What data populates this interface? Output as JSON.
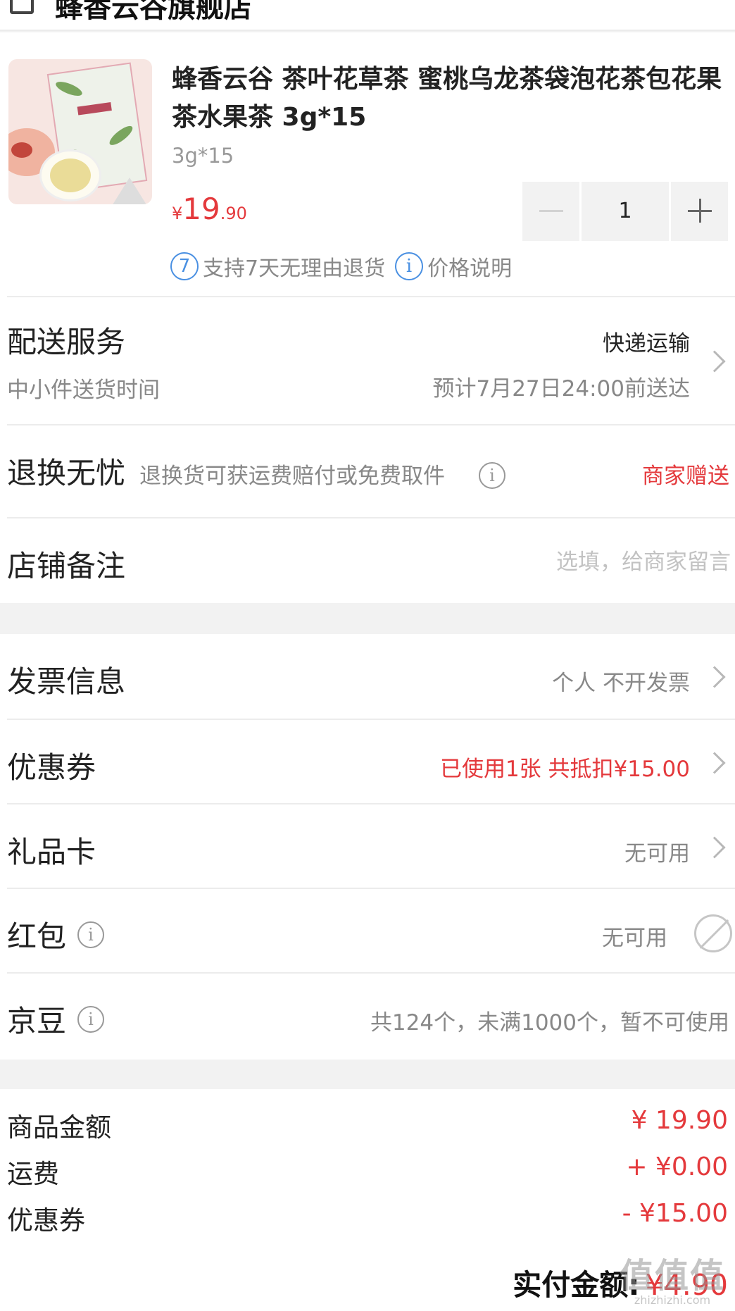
{
  "store": {
    "name": "蜂香云谷旗舰店"
  },
  "product": {
    "title": "蜂香云谷 茶叶花草茶 蜜桃乌龙茶袋泡花茶包花果茶水果茶 3g*15",
    "spec": "3g*15",
    "price_currency": "¥",
    "price_int": "19",
    "price_dec": ".90",
    "quantity": "1",
    "return_badge_num": "7",
    "return_policy": "支持7天无理由退货",
    "price_note": "价格说明"
  },
  "delivery": {
    "label": "配送服务",
    "sub": "中小件送货时间",
    "method": "快递运输",
    "eta": "预计7月27日24:00前送达"
  },
  "return_service": {
    "label": "退换无忧",
    "desc": "退换货可获运费赔付或免费取件",
    "value": "商家赠送"
  },
  "store_note": {
    "label": "店铺备注",
    "placeholder": "选填，给商家留言"
  },
  "options": {
    "invoice": {
      "label": "发票信息",
      "value": "个人 不开发票"
    },
    "coupon": {
      "label": "优惠券",
      "value": "已使用1张 共抵扣¥15.00"
    },
    "gift_card": {
      "label": "礼品卡",
      "value": "无可用"
    },
    "red_packet": {
      "label": "红包",
      "value": "无可用"
    },
    "jd_beans": {
      "label": "京豆",
      "value": "共124个，未满1000个，暂不可使用"
    }
  },
  "summary": {
    "goods_label": "商品金额",
    "goods_value": "¥ 19.90",
    "shipping_label": "运费",
    "shipping_value": "+ ¥0.00",
    "coupon_label": "优惠券",
    "coupon_value": "- ¥15.00",
    "total_label": "实付金额:",
    "total_value": "¥4.90"
  },
  "watermark": {
    "big": "值值值",
    "small": "zhizhizhi.com"
  },
  "colors": {
    "accent_red": "#e4393c",
    "info_blue": "#4a90e2"
  }
}
